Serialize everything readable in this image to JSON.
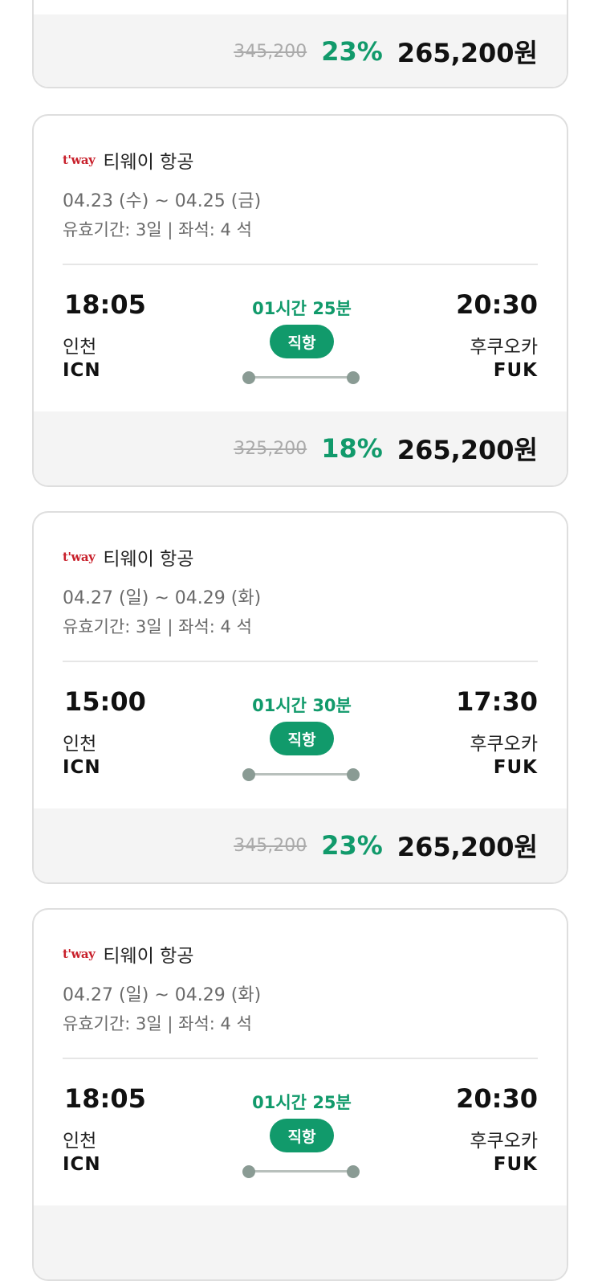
{
  "cards": [
    {
      "price": {
        "original": "345,200",
        "discount": "23%",
        "final": "265,200원"
      }
    },
    {
      "airline": {
        "logo": "t'way",
        "name": "티웨이 항공"
      },
      "dates": "04.23 (수) ~ 04.25 (금)",
      "validity": "유효기간: 3일 | 좌석: 4 석",
      "departure": {
        "time": "18:05",
        "city": "인천",
        "code": "ICN"
      },
      "arrival": {
        "time": "20:30",
        "city": "후쿠오카",
        "code": "FUK"
      },
      "duration": "01시간 25분",
      "flight_type": "직항",
      "price": {
        "original": "325,200",
        "discount": "18%",
        "final": "265,200원"
      }
    },
    {
      "airline": {
        "logo": "t'way",
        "name": "티웨이 항공"
      },
      "dates": "04.27 (일) ~ 04.29 (화)",
      "validity": "유효기간: 3일 | 좌석: 4 석",
      "departure": {
        "time": "15:00",
        "city": "인천",
        "code": "ICN"
      },
      "arrival": {
        "time": "17:30",
        "city": "후쿠오카",
        "code": "FUK"
      },
      "duration": "01시간 30분",
      "flight_type": "직항",
      "price": {
        "original": "345,200",
        "discount": "23%",
        "final": "265,200원"
      }
    },
    {
      "airline": {
        "logo": "t'way",
        "name": "티웨이 항공"
      },
      "dates": "04.27 (일) ~ 04.29 (화)",
      "validity": "유효기간: 3일 | 좌석: 4 석",
      "departure": {
        "time": "18:05",
        "city": "인천",
        "code": "ICN"
      },
      "arrival": {
        "time": "20:30",
        "city": "후쿠오카",
        "code": "FUK"
      },
      "duration": "01시간 25분",
      "flight_type": "직항"
    }
  ],
  "colors": {
    "accent": "#119a6b",
    "logo": "#c8202b",
    "footer_bg": "#f4f4f4"
  }
}
